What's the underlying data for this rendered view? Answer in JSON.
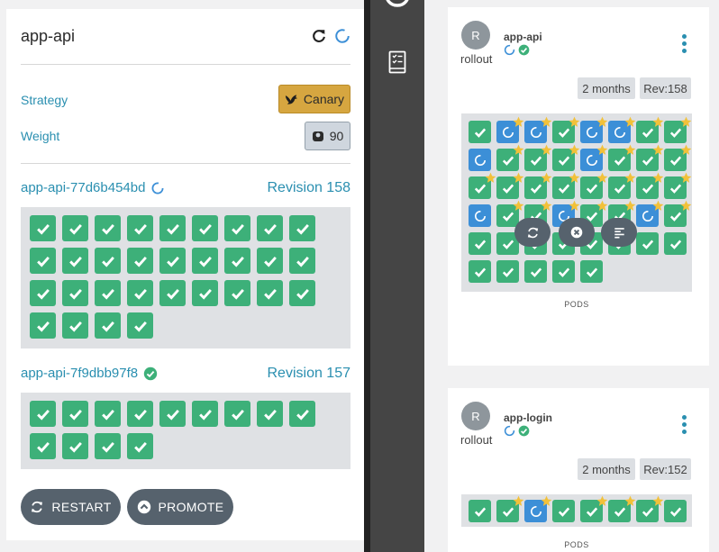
{
  "detail": {
    "title": "app-api",
    "strategy_label": "Strategy",
    "strategy_value": "Canary",
    "weight_label": "Weight",
    "weight_value": "90",
    "replicasets": [
      {
        "name": "app-api-77d6b454bd",
        "status": "progressing",
        "revision": "Revision 158",
        "pod_count": 31
      },
      {
        "name": "app-api-7f9dbb97f8",
        "status": "healthy",
        "revision": "Revision 157",
        "pod_count": 13
      }
    ],
    "buttons": {
      "restart": "RESTART",
      "promote": "PROMOTE"
    }
  },
  "rollouts": [
    {
      "avatar": "R",
      "name": "app-api",
      "kind": "rollout",
      "age": "2 months",
      "revision": "Rev:158",
      "pods_label": "PODS",
      "pods": [
        [
          "h",
          0
        ],
        [
          "p",
          1
        ],
        [
          "p",
          1
        ],
        [
          "h",
          1
        ],
        [
          "p",
          1
        ],
        [
          "p",
          1
        ],
        [
          "h",
          1
        ],
        [
          "h",
          1
        ],
        [
          "p",
          0
        ],
        [
          "h",
          1
        ],
        [
          "h",
          1
        ],
        [
          "h",
          1
        ],
        [
          "p",
          1
        ],
        [
          "h",
          1
        ],
        [
          "h",
          1
        ],
        [
          "h",
          1
        ],
        [
          "h",
          1
        ],
        [
          "h",
          1
        ],
        [
          "h",
          1
        ],
        [
          "h",
          1
        ],
        [
          "h",
          1
        ],
        [
          "h",
          1
        ],
        [
          "h",
          1
        ],
        [
          "h",
          1
        ],
        [
          "p",
          0
        ],
        [
          "h",
          1
        ],
        [
          "h",
          1
        ],
        [
          "p",
          1
        ],
        [
          "h",
          1
        ],
        [
          "h",
          1
        ],
        [
          "p",
          1
        ],
        [
          "h",
          1
        ],
        [
          "h",
          0
        ],
        [
          "h",
          0
        ],
        [
          "h",
          0
        ],
        [
          "h",
          0
        ],
        [
          "h",
          0
        ],
        [
          "h",
          0
        ],
        [
          "h",
          0
        ],
        [
          "h",
          0
        ],
        [
          "h",
          0
        ],
        [
          "h",
          0
        ],
        [
          "h",
          0
        ],
        [
          "h",
          0
        ],
        [
          "h",
          0
        ]
      ]
    },
    {
      "avatar": "R",
      "name": "app-login",
      "kind": "rollout",
      "age": "2 months",
      "revision": "Rev:152",
      "pods_label": "PODS",
      "pods": [
        [
          "h",
          0
        ],
        [
          "h",
          1
        ],
        [
          "p",
          1
        ],
        [
          "h",
          0
        ],
        [
          "h",
          1
        ],
        [
          "h",
          1
        ],
        [
          "h",
          1
        ],
        [
          "h",
          0
        ]
      ]
    }
  ],
  "colors": {
    "healthy": "#3db079",
    "progressing": "#3c8fd7",
    "canary": "#d6a640",
    "link": "#2a8fb0",
    "star": "#f2c13a",
    "sidebar": "#454545"
  },
  "icons": {
    "refresh": "refresh-icon",
    "spinner": "spinner-icon",
    "bird": "canary-bird-icon",
    "weight": "weight-icon",
    "check": "check-icon",
    "star": "star-icon",
    "restart": "restart-icon",
    "promote": "promote-icon",
    "abort": "abort-icon",
    "details": "details-icon"
  }
}
